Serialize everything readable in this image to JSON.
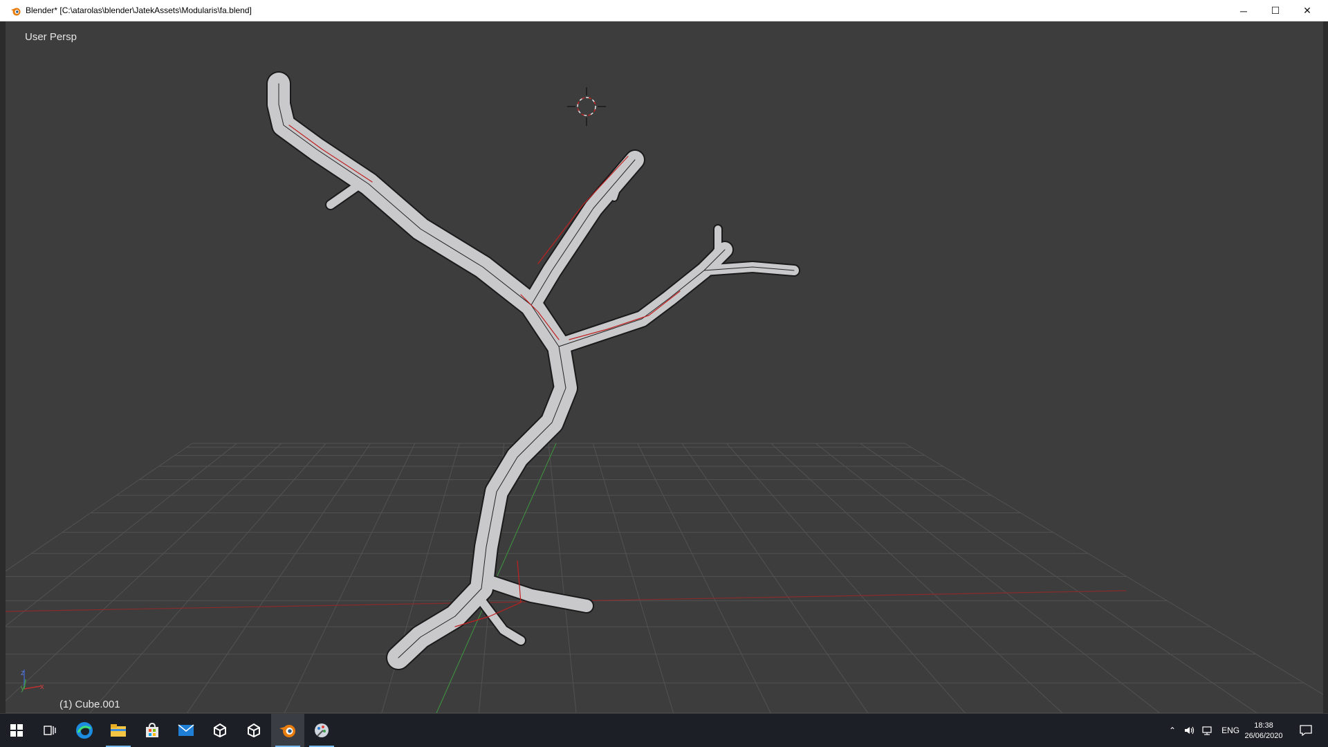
{
  "window": {
    "title": "Blender* [C:\\atarolas\\blender\\JatekAssets\\Modularis\\fa.blend]",
    "controls": {
      "minimize": "─",
      "maximize": "☐",
      "close": "✕"
    }
  },
  "viewport": {
    "view_label": "User Persp",
    "object_label": "(1) Cube.001",
    "axes": {
      "x": "x",
      "y": "y",
      "z": "z"
    }
  },
  "taskbar": {
    "apps": [
      {
        "name": "windows-start-icon"
      },
      {
        "name": "task-view-icon"
      },
      {
        "name": "edge-icon"
      },
      {
        "name": "file-explorer-icon"
      },
      {
        "name": "store-icon"
      },
      {
        "name": "mail-icon"
      },
      {
        "name": "unity-icon"
      },
      {
        "name": "unity-icon-2"
      },
      {
        "name": "blender-icon"
      },
      {
        "name": "paint-icon"
      }
    ],
    "tray": {
      "language": "ENG",
      "time": "18:38",
      "date": "26/06/2020"
    }
  },
  "colors": {
    "viewport_bg": "#3d3d3d",
    "grid": "#525252",
    "x_axis": "#8a2b2b",
    "y_axis": "#3f8a3f",
    "mesh": "#c9c9cc",
    "seam": "#c02020",
    "taskbar": "#1c1f26"
  }
}
